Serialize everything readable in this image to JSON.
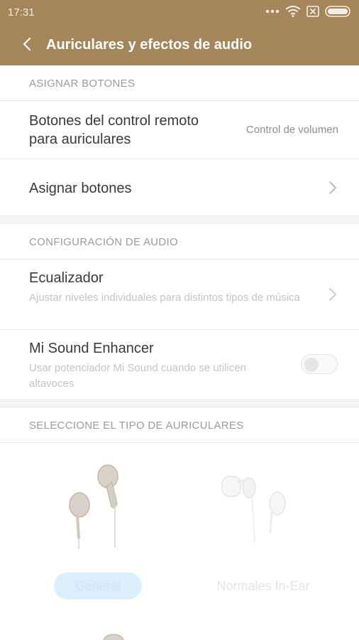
{
  "status_bar": {
    "time": "17:31",
    "icons": [
      "more-dots-icon",
      "wifi-icon",
      "sim-x-icon",
      "battery-icon"
    ]
  },
  "app_bar": {
    "title": "Auriculares y efectos de audio",
    "back_icon": "chevron-left-icon"
  },
  "section_assign": {
    "header": "ASIGNAR BOTONES",
    "items": [
      {
        "label": "Botones del control remoto para auriculares",
        "value": "Control de volumen"
      },
      {
        "label": "Asignar botones"
      }
    ]
  },
  "section_audio": {
    "header": "CONFIGURACIÓN DE AUDIO",
    "items": [
      {
        "label": "Ecualizador",
        "subtitle": "Ajustar niveles individuales para distintos tipos de música"
      },
      {
        "label": "Mi Sound Enhancer",
        "subtitle": "Usar potenciador Mi Sound cuando se utilicen altavoces",
        "toggle_on": false
      }
    ]
  },
  "section_type": {
    "header": "SELECCIONE EL TIPO DE AURICULARES",
    "options": [
      {
        "label": "General",
        "selected": true
      },
      {
        "label": "Normales In-Ear",
        "selected": false
      }
    ]
  },
  "colors": {
    "header_bg": "#a5865a",
    "selected_button_bg": "#dbeefc"
  }
}
